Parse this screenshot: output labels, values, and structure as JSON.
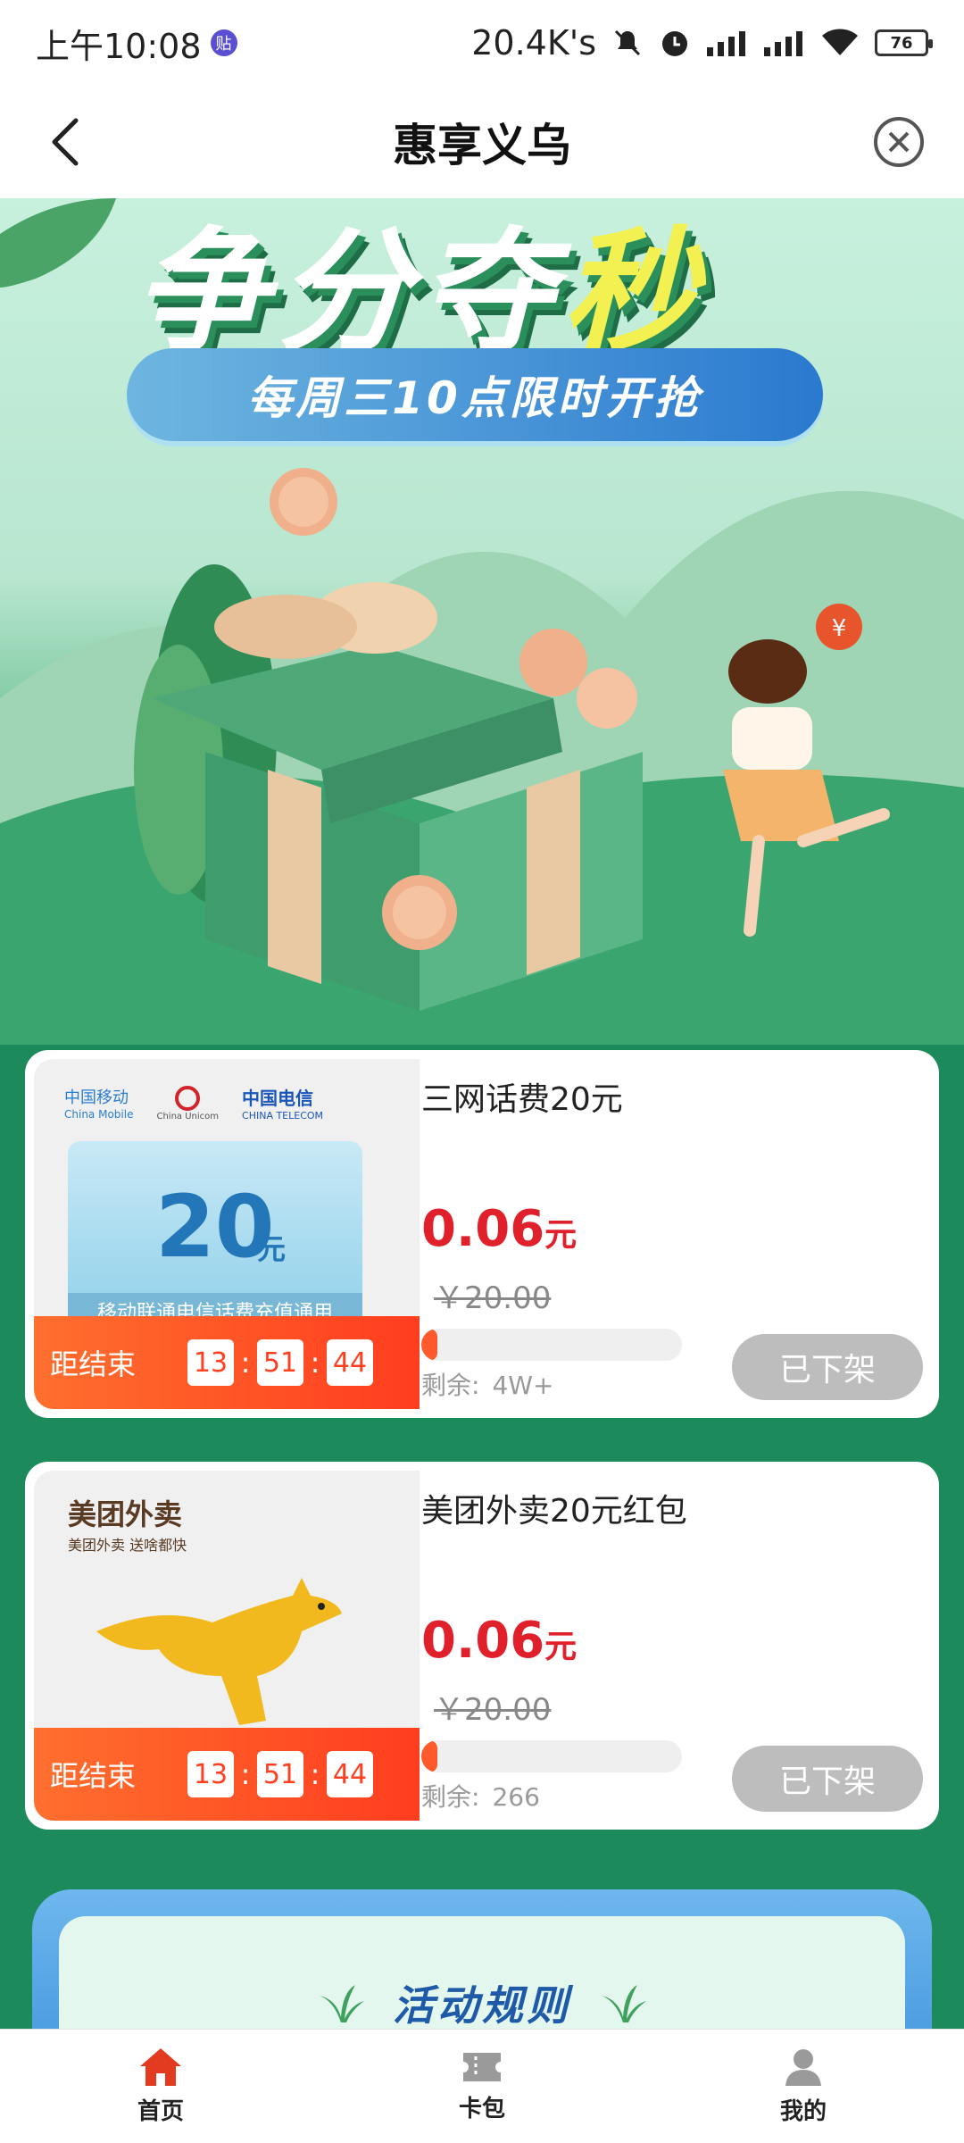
{
  "status_bar": {
    "time": "上午10:08",
    "badge": "贴",
    "net_speed": "20.4K's",
    "battery": "76"
  },
  "header": {
    "title": "惠享义乌"
  },
  "banner": {
    "headline_main": "争分夺",
    "headline_highlight": "秒",
    "subtitle": "每周三10点限时开抢"
  },
  "products": [
    {
      "name": "三网话费20元",
      "price": "0.06",
      "price_unit": "元",
      "original_price": "￥20.00",
      "progress_fraction": 0.01,
      "remain_label": "剩余:",
      "remain_value": "4W+",
      "button_label": "已下架",
      "timer_label": "距结束",
      "timer": [
        "13",
        "51",
        "44"
      ],
      "thumb": {
        "carrier1": "中国移动",
        "carrier1_en": "China Mobile",
        "carrier2_en": "China Unicom",
        "carrier3": "中国电信",
        "carrier3_en": "CHINA TELECOM",
        "amount": "20",
        "amount_unit": "元",
        "caption": "移动联通电信话费充值通用"
      }
    },
    {
      "name": "美团外卖20元红包",
      "price": "0.06",
      "price_unit": "元",
      "original_price": "￥20.00",
      "progress_fraction": 0.06,
      "remain_label": "剩余:",
      "remain_value": "266",
      "button_label": "已下架",
      "timer_label": "距结束",
      "timer": [
        "13",
        "51",
        "44"
      ],
      "thumb": {
        "brand": "美团外卖",
        "slogan": "美团外卖 送啥都快"
      }
    }
  ],
  "rules": {
    "title": "活动规则"
  },
  "bottom_nav": [
    {
      "label": "首页",
      "icon": "home-icon",
      "active": true
    },
    {
      "label": "卡包",
      "icon": "ticket-icon",
      "active": false
    },
    {
      "label": "我的",
      "icon": "user-icon",
      "active": false
    }
  ],
  "colors": {
    "accent_red": "#e0202a",
    "timer_orange": "#ff5a2b",
    "active_nav": "#e23b1f",
    "background_green": "#1c8a5a"
  }
}
